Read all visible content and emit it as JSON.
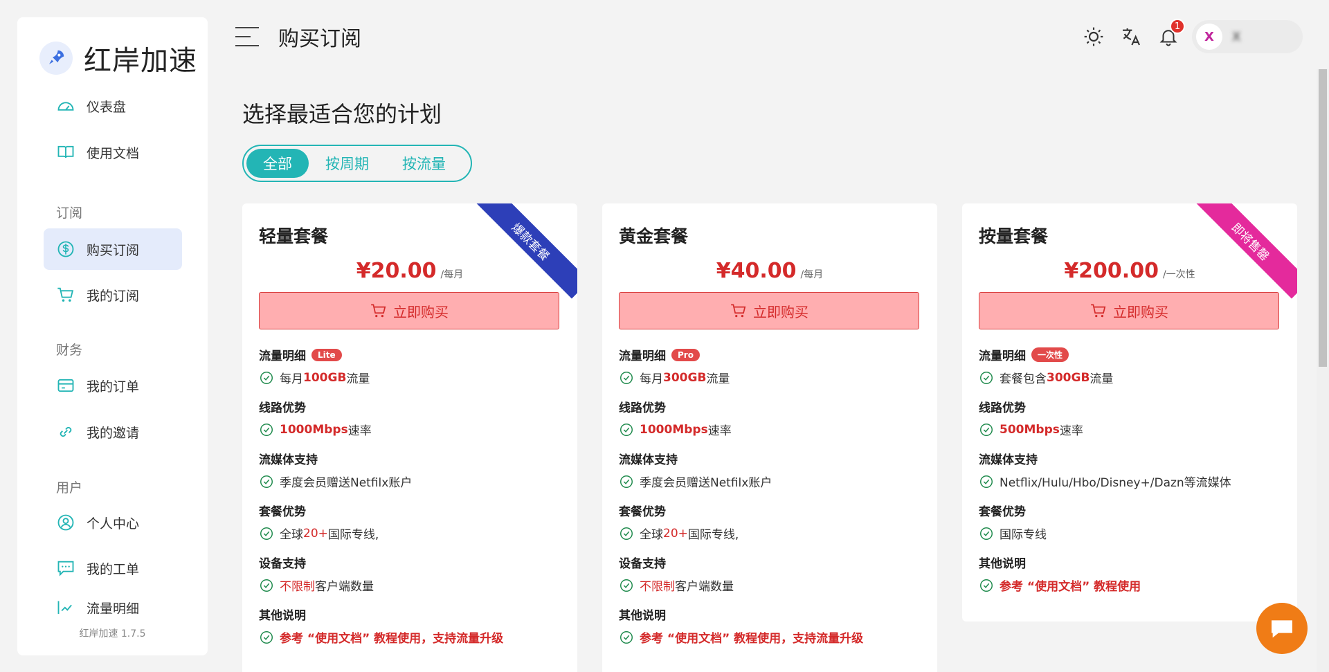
{
  "brand": {
    "name": "红岸加速"
  },
  "sidebar": {
    "items": [
      {
        "label": "仪表盘"
      },
      {
        "label": "使用文档"
      },
      {
        "label": "购买订阅"
      },
      {
        "label": "我的订阅"
      },
      {
        "label": "我的订单"
      },
      {
        "label": "我的邀请"
      },
      {
        "label": "个人中心"
      },
      {
        "label": "我的工单"
      },
      {
        "label": "流量明细"
      }
    ],
    "sections": [
      "订阅",
      "财务",
      "用户"
    ],
    "version": "红岸加速 1.7.5"
  },
  "header": {
    "title": "购买订阅",
    "notification_count": "1",
    "avatar_letter": "X",
    "username": "X"
  },
  "main": {
    "title": "选择最适合您的计划",
    "filters": [
      "全部",
      "按周期",
      "按流量"
    ]
  },
  "plans": [
    {
      "name": "轻量套餐",
      "ribbon": "爆款套餐",
      "price": "¥20.00",
      "period": "/每月",
      "buy": "立即购买",
      "f1_head": "流量明细",
      "f1_tag": "Lite",
      "f1_a": "每月 ",
      "f1_b": "100GB",
      "f1_c": " 流量",
      "f2_head": "线路优势",
      "f2_b": "1000Mbps",
      "f2_c": " 速率",
      "f3_head": "流媒体支持",
      "f3_a": "季度会员赠送Netfilx账户",
      "f4_head": "套餐优势",
      "f4_a": "全球 ",
      "f4_b": "20+",
      "f4_c": " 国际专线,",
      "f5_head": "设备支持",
      "f5_b": "不限制",
      "f5_c": " 客户端数量",
      "f6_head": "其他说明",
      "f6_b": "参考 “使用文档” 教程使用，支持流量升级"
    },
    {
      "name": "黄金套餐",
      "price": "¥40.00",
      "period": "/每月",
      "buy": "立即购买",
      "f1_head": "流量明细",
      "f1_tag": "Pro",
      "f1_a": "每月 ",
      "f1_b": "300GB",
      "f1_c": " 流量",
      "f2_head": "线路优势",
      "f2_b": "1000Mbps",
      "f2_c": " 速率",
      "f3_head": "流媒体支持",
      "f3_a": "季度会员赠送Netfilx账户",
      "f4_head": "套餐优势",
      "f4_a": "全球 ",
      "f4_b": "20+",
      "f4_c": " 国际专线,",
      "f5_head": "设备支持",
      "f5_b": "不限制",
      "f5_c": " 客户端数量",
      "f6_head": "其他说明",
      "f6_b": "参考 “使用文档” 教程使用，支持流量升级"
    },
    {
      "name": "按量套餐",
      "ribbon": "即将售罄",
      "price": "¥200.00",
      "period": "/一次性",
      "buy": "立即购买",
      "f1_head": "流量明细",
      "f1_tag": "一次性",
      "f1_a": "套餐包含 ",
      "f1_b": "300GB",
      "f1_c": " 流量",
      "f2_head": "线路优势",
      "f2_b": "500Mbps",
      "f2_c": " 速率",
      "f3_head": "流媒体支持",
      "f3_a": "Netflix/Hulu/Hbo/Disney+/Dazn等流媒体",
      "f4_head": "套餐优势",
      "f4_a": "国际专线",
      "f6_head": "其他说明",
      "f6_b": "参考 “使用文档” 教程使用"
    }
  ],
  "colors": {
    "accent": "#23b5b5",
    "price": "#d42a2a",
    "ribbon_blue": "#2d3fb8",
    "ribbon_pink": "#e42a9c",
    "chat": "#f07c16"
  }
}
